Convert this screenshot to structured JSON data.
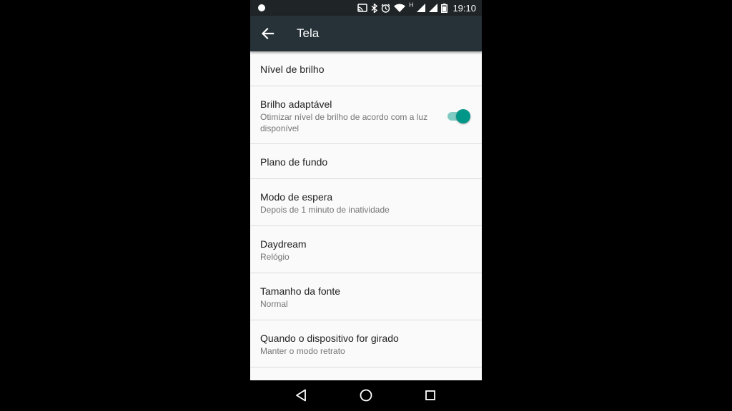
{
  "statusbar": {
    "time": "19:10",
    "signal_type": "H",
    "icons": [
      "notification-dot-icon",
      "cast-icon",
      "bluetooth-icon",
      "alarm-icon",
      "wifi-icon",
      "cell-signal-icon",
      "cell-signal-icon",
      "battery-icon"
    ]
  },
  "appbar": {
    "title": "Tela",
    "back_icon": "arrow-back-icon"
  },
  "settings": {
    "items": [
      {
        "title": "Nível de brilho"
      },
      {
        "title": "Brilho adaptável",
        "subtitle": "Otimizar nível de brilho de acordo com a luz disponível",
        "toggle": true
      },
      {
        "title": "Plano de fundo"
      },
      {
        "title": "Modo de espera",
        "subtitle": "Depois de 1 minuto de inatividade"
      },
      {
        "title": "Daydream",
        "subtitle": "Relógio"
      },
      {
        "title": "Tamanho da fonte",
        "subtitle": "Normal"
      },
      {
        "title": "Quando o dispositivo for girado",
        "subtitle": "Manter o modo retrato"
      }
    ]
  },
  "navbar": {
    "icons": [
      "back-triangle-icon",
      "home-circle-icon",
      "recents-square-icon"
    ]
  },
  "colors": {
    "appbar": "#263238",
    "statusbar": "#1f2426",
    "accent": "#009688",
    "accent_track": "#80cbc4",
    "background": "#fafafa"
  }
}
